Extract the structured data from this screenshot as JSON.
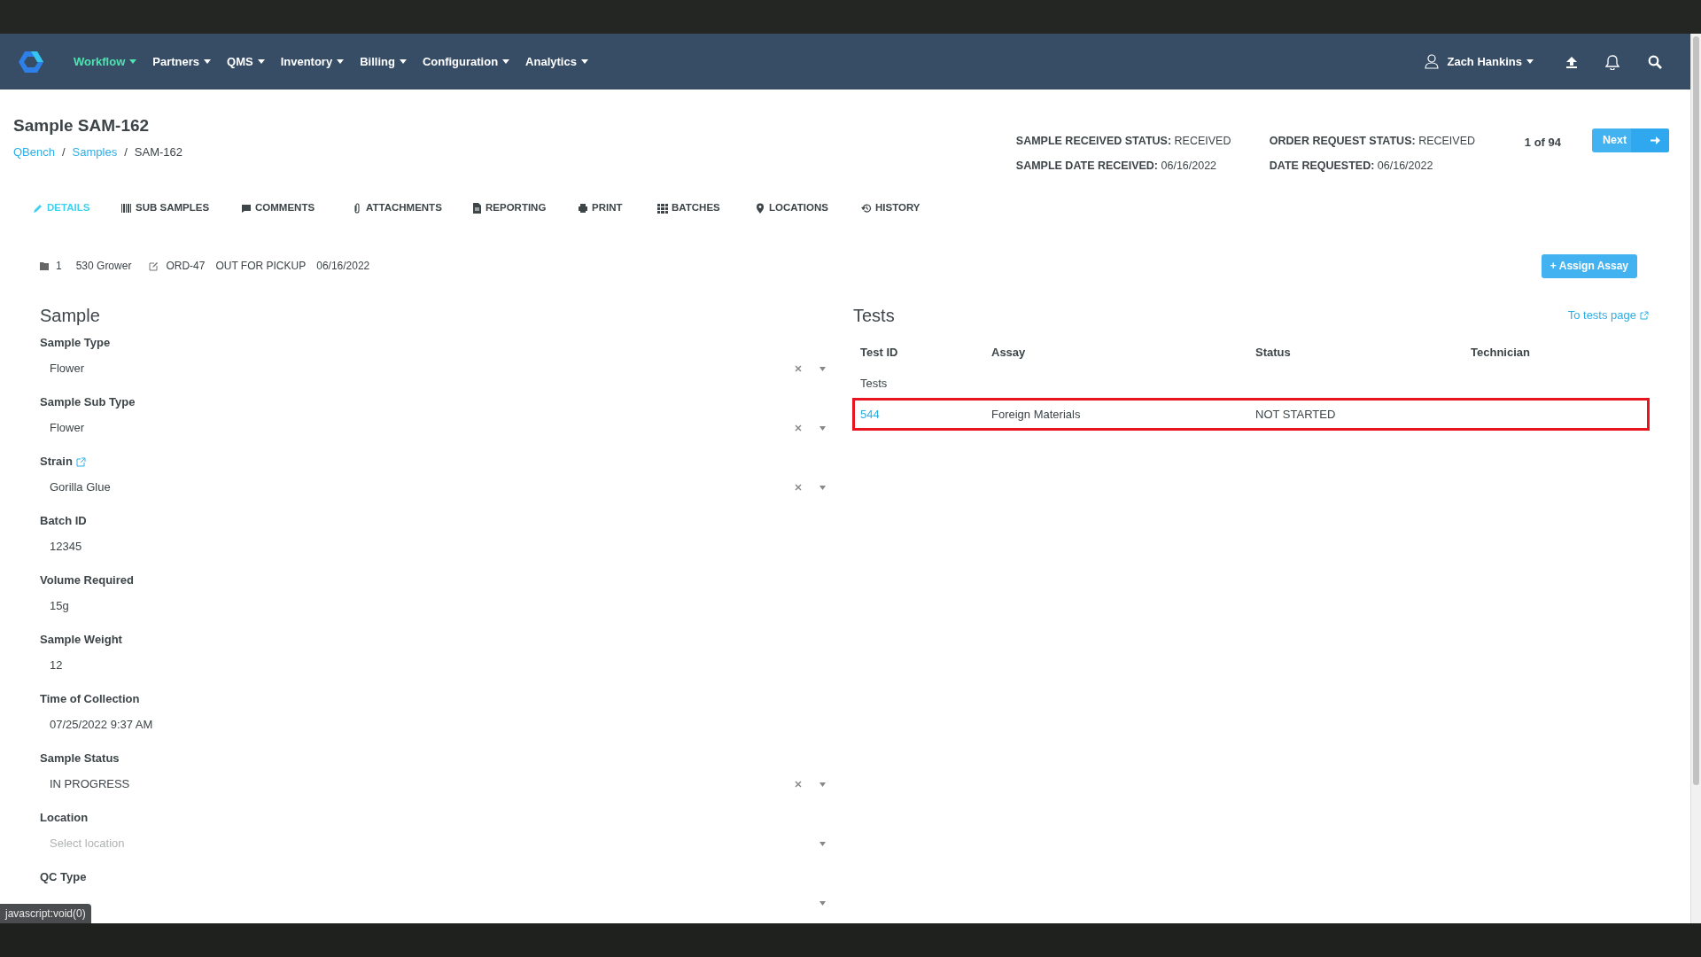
{
  "navbar": {
    "menus": [
      {
        "label": "Workflow",
        "selected": true
      },
      {
        "label": "Partners",
        "selected": false
      },
      {
        "label": "QMS",
        "selected": false
      },
      {
        "label": "Inventory",
        "selected": false
      },
      {
        "label": "Billing",
        "selected": false
      },
      {
        "label": "Configuration",
        "selected": false
      },
      {
        "label": "Analytics",
        "selected": false
      }
    ],
    "user": "Zach Hankins"
  },
  "page": {
    "title": "Sample SAM-162",
    "breadcrumb": [
      {
        "label": "QBench",
        "link": true
      },
      {
        "label": "Samples",
        "link": true,
        "separator": "/"
      },
      {
        "label": "SAM-162",
        "link": false,
        "separator": "/"
      }
    ]
  },
  "status_info": [
    [
      {
        "label": "SAMPLE RECEIVED STATUS:",
        "value": "RECEIVED"
      },
      {
        "label": "SAMPLE DATE RECEIVED:",
        "value": "06/16/2022"
      }
    ],
    [
      {
        "label": "ORDER REQUEST STATUS:",
        "value": "RECEIVED"
      },
      {
        "label": "DATE REQUESTED:",
        "value": "06/16/2022"
      }
    ]
  ],
  "pagination": {
    "text": "1 of 94",
    "next": "Next"
  },
  "tabs": [
    {
      "label": "DETAILS",
      "selected": true
    },
    {
      "label": "SUB SAMPLES",
      "selected": false
    },
    {
      "label": "COMMENTS",
      "selected": false
    },
    {
      "label": "ATTACHMENTS",
      "selected": false
    },
    {
      "label": "REPORTING",
      "selected": false
    },
    {
      "label": "PRINT",
      "selected": false
    },
    {
      "label": "BATCHES",
      "selected": false
    },
    {
      "label": "LOCATIONS",
      "selected": false
    },
    {
      "label": "HISTORY",
      "selected": false
    }
  ],
  "summary": {
    "count": "1",
    "client": "530 Grower",
    "order": "ORD-47",
    "order_status": "OUT FOR PICKUP",
    "date": "06/16/2022"
  },
  "assign_button": "+ Assign Assay",
  "sample": {
    "title": "Sample",
    "fields": [
      {
        "label": "Sample Type",
        "kind": "select",
        "value": "Flower",
        "clearable": true
      },
      {
        "label": "Sample Sub Type",
        "kind": "select",
        "value": "Flower",
        "clearable": true
      },
      {
        "label": "Strain",
        "kind": "select",
        "value": "Gorilla Glue",
        "clearable": true,
        "link": true
      },
      {
        "label": "Batch ID",
        "kind": "text",
        "value": "12345"
      },
      {
        "label": "Volume Required",
        "kind": "text",
        "value": "15g"
      },
      {
        "label": "Sample Weight",
        "kind": "text",
        "value": "12"
      },
      {
        "label": "Time of Collection",
        "kind": "text",
        "value": "07/25/2022 9:37 AM"
      },
      {
        "label": "Sample Status",
        "kind": "select",
        "value": "IN PROGRESS",
        "clearable": true
      },
      {
        "label": "Location",
        "kind": "select",
        "placeholder": "Select location",
        "clearable": false
      },
      {
        "label": "QC Type",
        "kind": "select",
        "clearable": false
      }
    ]
  },
  "tests": {
    "title": "Tests",
    "link": "To tests page",
    "columns": [
      "Test ID",
      "Assay",
      "Status",
      "Technician"
    ],
    "group": "Tests",
    "rows": [
      {
        "test_id": "544",
        "assay": "Foreign Materials",
        "status": "NOT STARTED",
        "highlighted": true
      }
    ]
  },
  "status_bar": "javascript:void(0)"
}
